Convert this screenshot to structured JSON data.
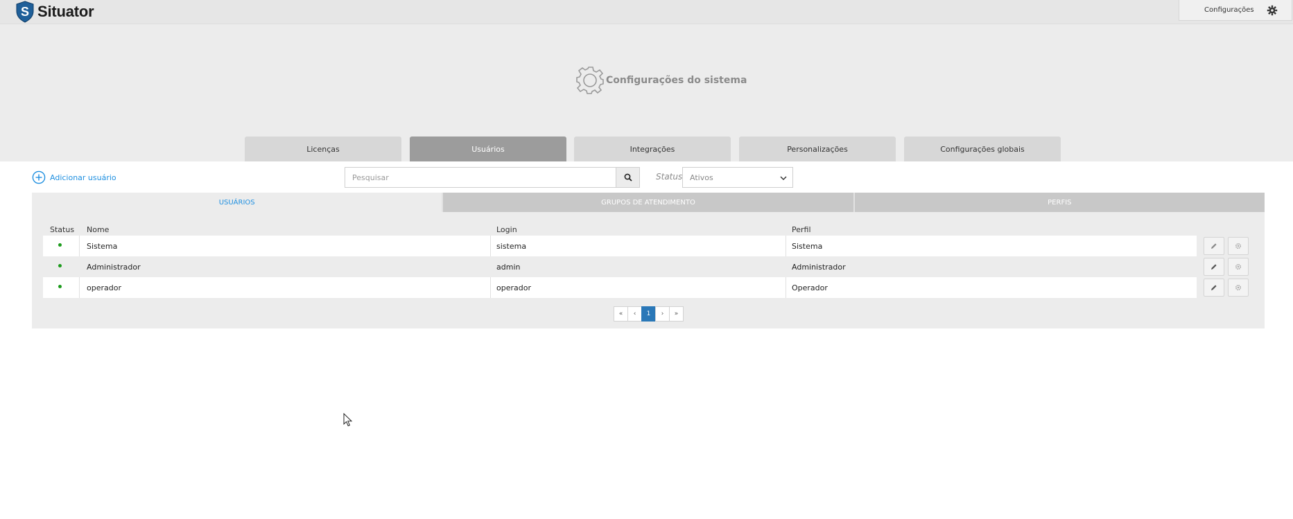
{
  "app": {
    "name": "Situator",
    "config_button_label": "Configurações"
  },
  "page": {
    "title": "Configurações do sistema"
  },
  "main_tabs": [
    {
      "label": "Licenças",
      "active": false
    },
    {
      "label": "Usuários",
      "active": true
    },
    {
      "label": "Integrações",
      "active": false
    },
    {
      "label": "Personalizações",
      "active": false
    },
    {
      "label": "Configurações globais",
      "active": false
    }
  ],
  "toolbar": {
    "add_user_label": "Adicionar usuário",
    "search_placeholder": "Pesquisar",
    "status_label": "Status",
    "status_value": "Ativos"
  },
  "sub_tabs": [
    {
      "label": "USUÁRIOS",
      "active": true
    },
    {
      "label": "GRUPOS DE ATENDIMENTO",
      "active": false
    },
    {
      "label": "PERFIS",
      "active": false
    }
  ],
  "table": {
    "headers": [
      "Status",
      "Nome",
      "Login",
      "Perfil"
    ],
    "rows": [
      {
        "status": "active",
        "name": "Sistema",
        "login": "sistema",
        "profile": "Sistema"
      },
      {
        "status": "active",
        "name": "Administrador",
        "login": "admin",
        "profile": "Administrador"
      },
      {
        "status": "active",
        "name": "operador",
        "login": "operador",
        "profile": "Operador"
      }
    ]
  },
  "pagination": {
    "first": "«",
    "prev": "‹",
    "current": "1",
    "next": "›",
    "last": "»"
  },
  "colors": {
    "accent": "#1e8fe0",
    "active_tab": "#9c9c9c",
    "status_active": "#1a9a1a",
    "page_active": "#2a78b8"
  }
}
